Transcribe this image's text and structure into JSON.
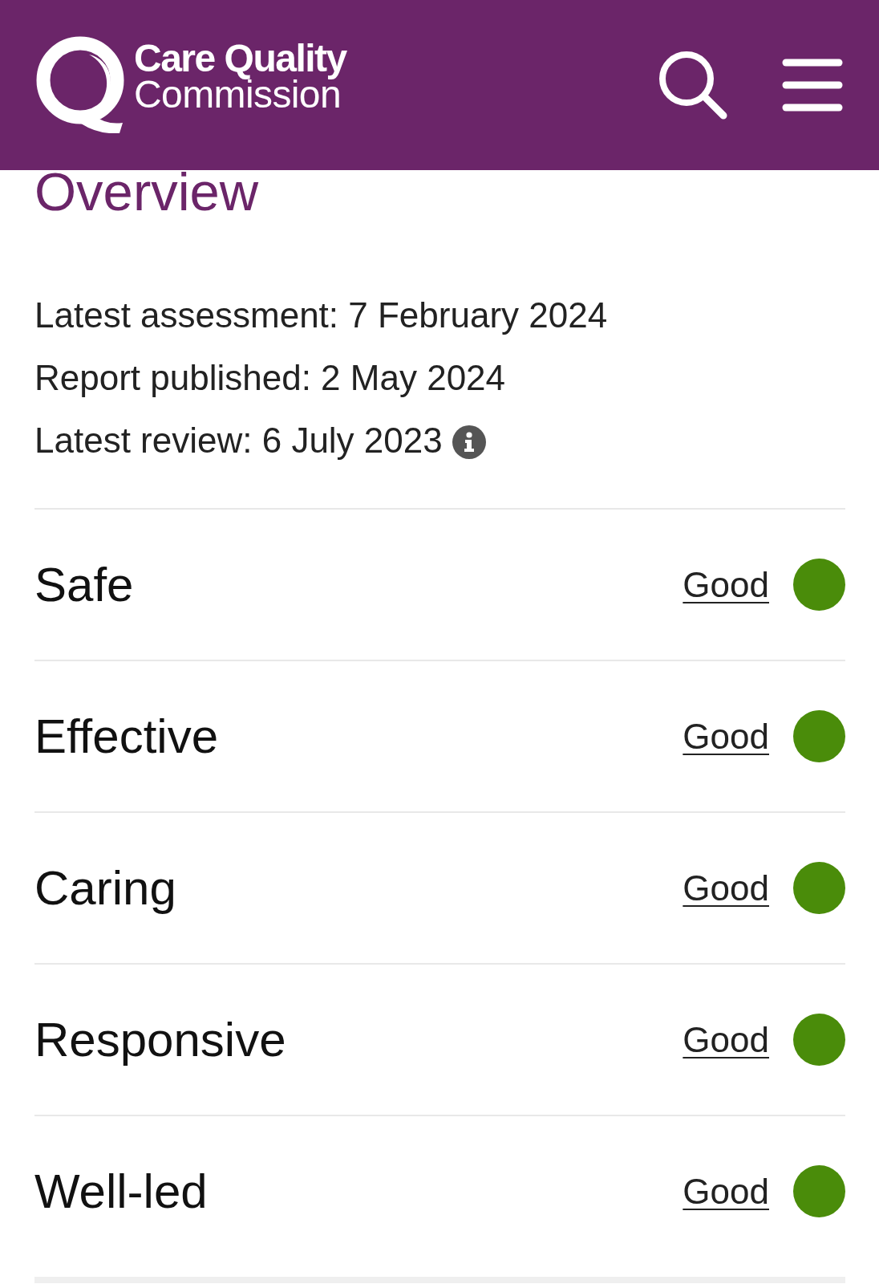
{
  "header": {
    "logo": {
      "line_1": "Care Quality",
      "line_2": "Commission"
    }
  },
  "overview": {
    "title": "Overview",
    "details": [
      {
        "text": "Latest assessment: 7 February 2024",
        "info_icon": false
      },
      {
        "text": "Report published: 2 May 2024",
        "info_icon": false
      },
      {
        "text": "Latest review: 6 July 2023",
        "info_icon": true
      }
    ]
  },
  "ratings": [
    {
      "area": "Safe",
      "rating": "Good",
      "color": "#4a8c0a"
    },
    {
      "area": "Effective",
      "rating": "Good",
      "color": "#4a8c0a"
    },
    {
      "area": "Caring",
      "rating": "Good",
      "color": "#4a8c0a"
    },
    {
      "area": "Responsive",
      "rating": "Good",
      "color": "#4a8c0a"
    },
    {
      "area": "Well-led",
      "rating": "Good",
      "color": "#4a8c0a"
    }
  ]
}
